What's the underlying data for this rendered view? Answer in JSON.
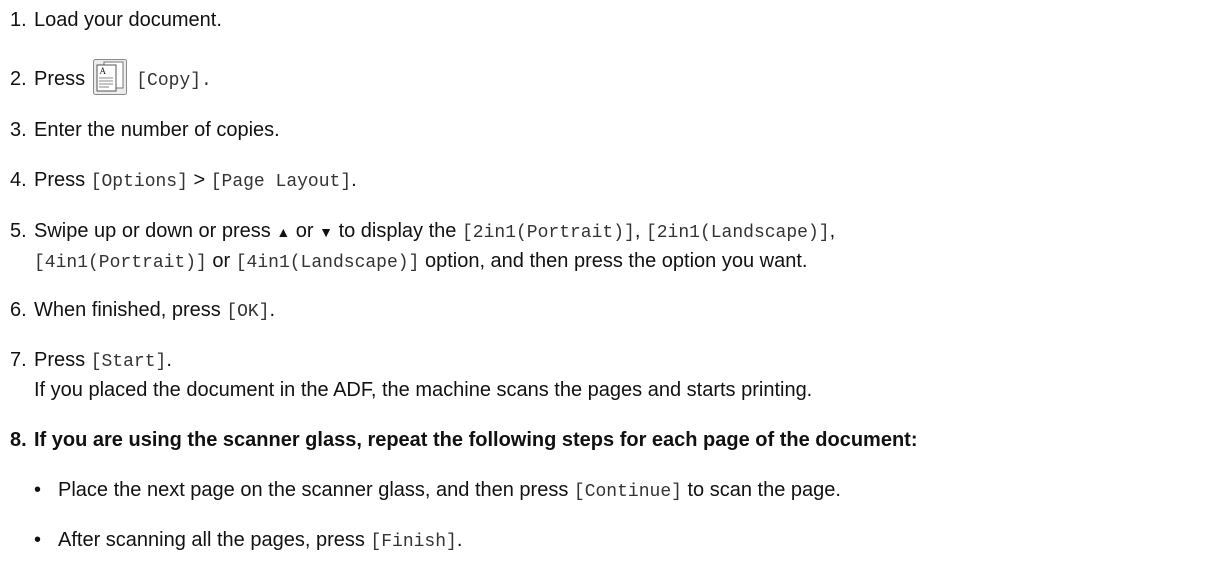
{
  "steps": [
    {
      "num": "1.",
      "text": "Load your document."
    },
    {
      "num": "2.",
      "text": "Press",
      "code": "[Copy]."
    },
    {
      "num": "3.",
      "text": "Enter the number of copies."
    },
    {
      "num": "4.",
      "text": "Press",
      "code1": "[Options]",
      "sep": ">",
      "code2": "[Page Layout]",
      "end": "."
    },
    {
      "num": "5.",
      "text1": "Swipe up or down or press",
      "up_arrow": "▲",
      "or": "or",
      "down_arrow": "▼",
      "text2": "to display the",
      "opt1": "[2in1(Portrait)]",
      "comma1": ",",
      "opt2": "[2in1(Landscape)]",
      "comma2": ",",
      "opt3": "[4in1(Portrait)]",
      "or2": "or",
      "opt4": "[4in1(Landscape)]",
      "text3": "option, and then press the option you want."
    },
    {
      "num": "6.",
      "text": "When finished, press",
      "code": "[OK]",
      "end": "."
    },
    {
      "num": "7.",
      "text": "Press",
      "code": "[Start]",
      "end": ".",
      "note": "If you placed the document in the ADF, the machine scans the pages and starts printing."
    },
    {
      "num": "8.",
      "text": "If you are using the scanner glass, repeat the following steps for each page of the document:"
    }
  ],
  "bullets": [
    {
      "bullet": "•",
      "text1": "Place the next page on the scanner glass, and then press",
      "code": "[Continue]",
      "text2": "to scan the page."
    },
    {
      "bullet": "•",
      "text1": "After scanning all the pages, press",
      "code": "[Finish]",
      "end": "."
    }
  ],
  "icons": {
    "copy": "copy-icon"
  }
}
